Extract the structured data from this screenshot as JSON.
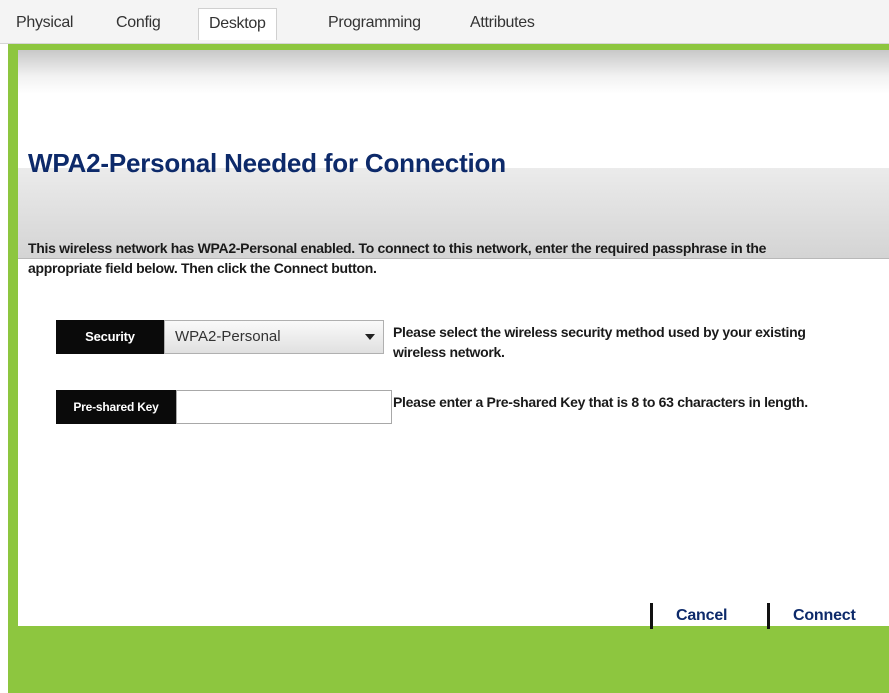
{
  "tabs": [
    {
      "label": "Physical"
    },
    {
      "label": "Config"
    },
    {
      "label": "Desktop"
    },
    {
      "label": "Programming"
    },
    {
      "label": "Attributes"
    }
  ],
  "active_tab": "Desktop",
  "dialog": {
    "title": "WPA2-Personal Needed for Connection",
    "description_part1": "This wireless network has WPA2-Personal enabled. To connect to this network, enter the required passphrase in the appropriate field below. Then click the ",
    "description_emphasis": "Connect",
    "description_part2": " button.",
    "security": {
      "label": "Security",
      "selected": "WPA2-Personal",
      "help": "Please select the wireless security method used by your existing wireless network."
    },
    "psk": {
      "label": "Pre-shared Key",
      "value": "",
      "help": "Please enter a Pre-shared Key that is 8 to 63 characters in length."
    }
  },
  "footer": {
    "cancel_label": "Cancel",
    "connect_label": "Connect"
  },
  "colors": {
    "accent_green": "#8dc63f",
    "title_blue": "#0d2a6a",
    "label_black": "#0a0a0a"
  }
}
